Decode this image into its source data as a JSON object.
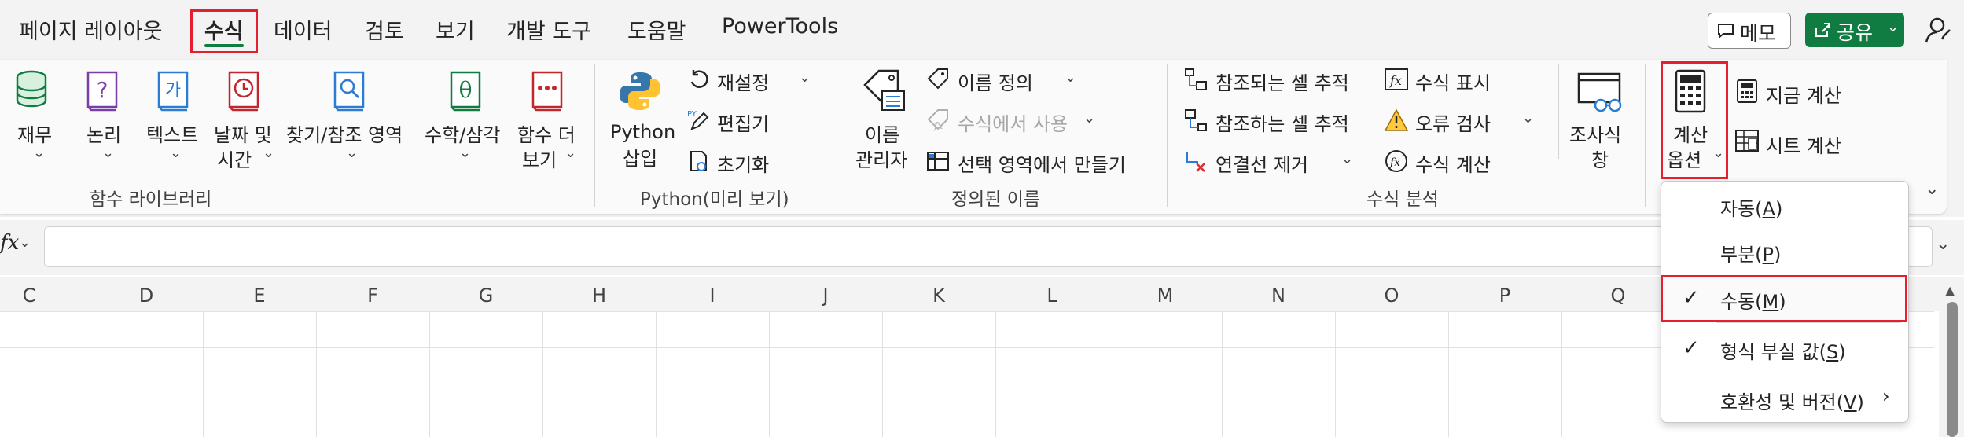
{
  "tabs": [
    {
      "label": "페이지 레이아웃",
      "active": false
    },
    {
      "label": "수식",
      "active": true
    },
    {
      "label": "데이터",
      "active": false
    },
    {
      "label": "검토",
      "active": false
    },
    {
      "label": "보기",
      "active": false
    },
    {
      "label": "개발 도구",
      "active": false
    },
    {
      "label": "도움말",
      "active": false
    },
    {
      "label": "PowerTools",
      "active": false
    }
  ],
  "header": {
    "memo_label": "메모",
    "share_label": "공유"
  },
  "ribbon": {
    "function_library": {
      "buttons": [
        "재무",
        "논리",
        "텍스트",
        "날짜 및",
        "시간",
        "찾기/참조 영역",
        "수학/삼각",
        "함수 더",
        "보기"
      ],
      "icon_glyphs": {
        "text": "가",
        "math": "θ"
      },
      "group_label": "함수 라이브러리"
    },
    "python": {
      "insert_line1": "Python",
      "insert_line2": "삽입",
      "reset": "재설정",
      "editor": "편집기",
      "initialize": "초기화",
      "group_label": "Python(미리 보기)"
    },
    "defined_names": {
      "manager_line1": "이름",
      "manager_line2": "관리자",
      "define_name": "이름 정의",
      "use_in_formula": "수식에서 사용",
      "create_from_selection": "선택 영역에서 만들기",
      "group_label": "정의된 이름"
    },
    "formula_auditing": {
      "trace_precedents": "참조되는 셀 추적",
      "trace_dependents": "참조하는 셀 추적",
      "remove_arrows": "연결선 제거",
      "show_formulas": "수식 표시",
      "error_checking": "오류 검사",
      "evaluate_formula": "수식 계산",
      "watch_line1": "조사식",
      "watch_line2": "창",
      "group_label": "수식 분석"
    },
    "calculation": {
      "options_line1": "계산",
      "options_line2": "옵션",
      "calc_now": "지금 계산",
      "calc_sheet": "시트 계산"
    }
  },
  "formula_bar": {
    "fx_label": "fx",
    "value": ""
  },
  "columns": [
    "C",
    "D",
    "E",
    "F",
    "G",
    "H",
    "I",
    "J",
    "K",
    "L",
    "M",
    "N",
    "O",
    "P",
    "Q"
  ],
  "calc_menu": {
    "items": [
      {
        "label": "자동",
        "key": "A",
        "checked": false
      },
      {
        "label": "부분",
        "key": "P",
        "checked": false
      },
      {
        "label": "수동",
        "key": "M",
        "checked": true
      },
      {
        "label": "형식 부실 값",
        "key": "S",
        "checked": true
      },
      {
        "label": "호환성 및 버전",
        "key": "V",
        "checked": false
      }
    ]
  },
  "colors": {
    "accent": "#107c41",
    "highlight": "#e5202e",
    "share_bg": "#107c41"
  }
}
